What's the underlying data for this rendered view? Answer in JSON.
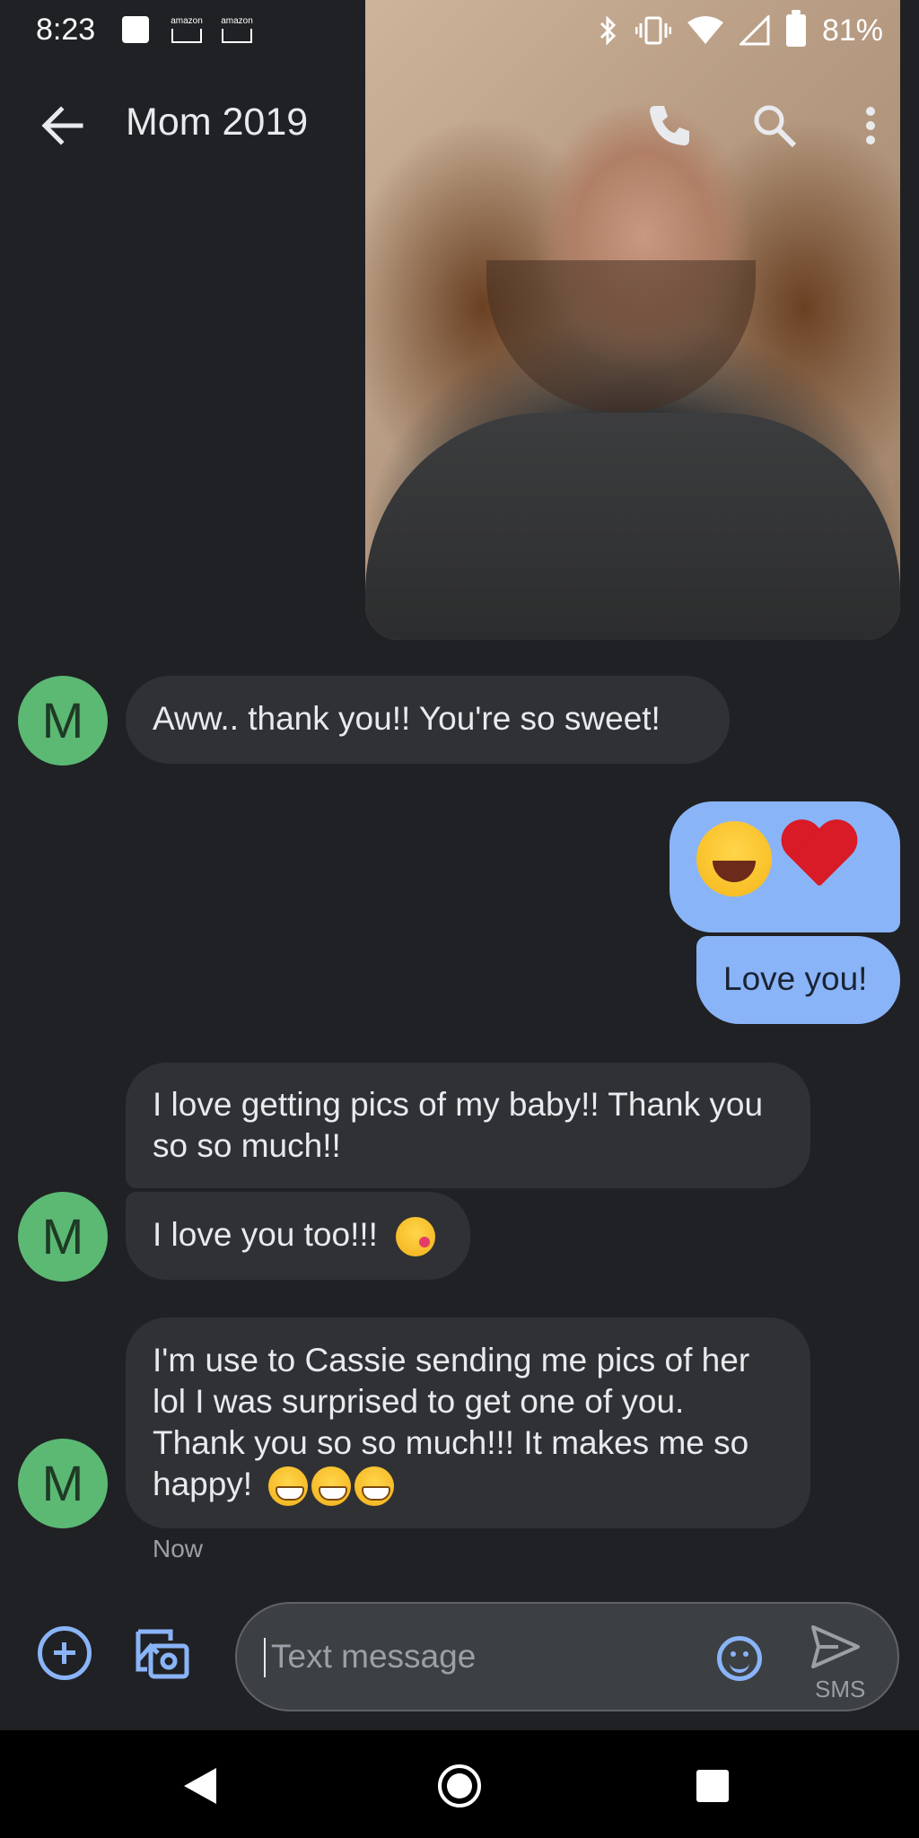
{
  "status_bar": {
    "time": "8:23",
    "amazon_label": "amazon",
    "battery_percent": "81%"
  },
  "header": {
    "title": "Mom 2019"
  },
  "messages": [
    {
      "direction": "incoming",
      "avatar_letter": "M",
      "text": "Aww.. thank you!! You're so sweet!"
    },
    {
      "direction": "outgoing",
      "emoji_names": [
        "face-with-tears-of-joy",
        "red-heart"
      ]
    },
    {
      "direction": "outgoing",
      "text": "Love you!"
    },
    {
      "direction": "incoming",
      "text": "I love getting pics of my baby!! Thank you so so much!!"
    },
    {
      "direction": "incoming",
      "avatar_letter": "M",
      "text": "I love you too!!!",
      "emoji_names": [
        "face-blowing-a-kiss"
      ]
    },
    {
      "direction": "incoming",
      "avatar_letter": "M",
      "text": "I'm use to Cassie sending me pics of her lol I was surprised to get one of you. Thank you so so much!!! It makes me so happy!",
      "emoji_names": [
        "grinning-face",
        "grinning-face",
        "grinning-face"
      ]
    }
  ],
  "timestamp": "Now",
  "compose": {
    "placeholder": "Text message",
    "send_label": "SMS"
  },
  "colors": {
    "background": "#202124",
    "incoming_bubble": "#303134",
    "outgoing_bubble": "#8ab4f8",
    "avatar": "#5bb974",
    "accent": "#8ab4f8"
  }
}
